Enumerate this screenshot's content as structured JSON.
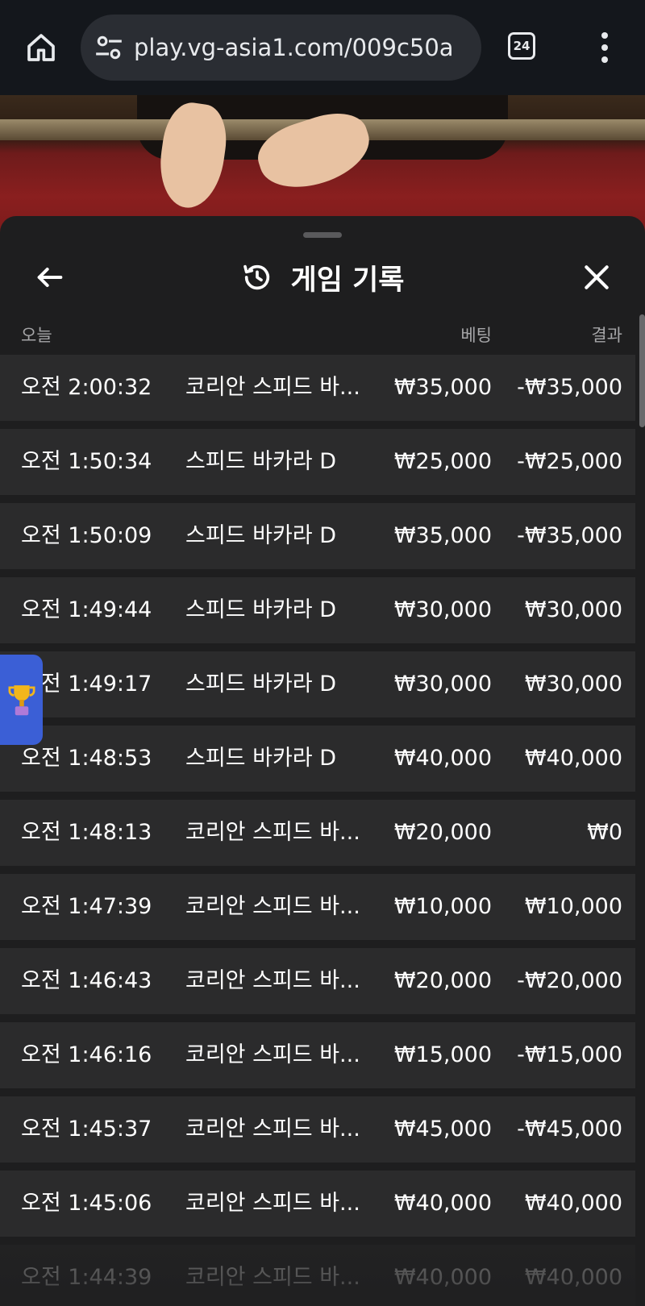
{
  "browser": {
    "url": "play.vg-asia1.com/009c50a",
    "tab_count": "24"
  },
  "sheet": {
    "title": "게임 기록",
    "columns": {
      "today": "오늘",
      "bet": "베팅",
      "result": "결과"
    },
    "rows": [
      {
        "time": "오전 2:00:32",
        "game": "코리안 스피드 바...",
        "bet": "₩35,000",
        "result": "-₩35,000"
      },
      {
        "time": "오전 1:50:34",
        "game": "스피드 바카라 D",
        "bet": "₩25,000",
        "result": "-₩25,000"
      },
      {
        "time": "오전 1:50:09",
        "game": "스피드 바카라 D",
        "bet": "₩35,000",
        "result": "-₩35,000"
      },
      {
        "time": "오전 1:49:44",
        "game": "스피드 바카라 D",
        "bet": "₩30,000",
        "result": "₩30,000"
      },
      {
        "time": "오전 1:49:17",
        "game": "스피드 바카라 D",
        "bet": "₩30,000",
        "result": "₩30,000"
      },
      {
        "time": "오전 1:48:53",
        "game": "스피드 바카라 D",
        "bet": "₩40,000",
        "result": "₩40,000"
      },
      {
        "time": "오전 1:48:13",
        "game": "코리안 스피드 바...",
        "bet": "₩20,000",
        "result": "₩0"
      },
      {
        "time": "오전 1:47:39",
        "game": "코리안 스피드 바...",
        "bet": "₩10,000",
        "result": "₩10,000"
      },
      {
        "time": "오전 1:46:43",
        "game": "코리안 스피드 바...",
        "bet": "₩20,000",
        "result": "-₩20,000"
      },
      {
        "time": "오전 1:46:16",
        "game": "코리안 스피드 바...",
        "bet": "₩15,000",
        "result": "-₩15,000"
      },
      {
        "time": "오전 1:45:37",
        "game": "코리안 스피드 바...",
        "bet": "₩45,000",
        "result": "-₩45,000"
      },
      {
        "time": "오전 1:45:06",
        "game": "코리안 스피드 바...",
        "bet": "₩40,000",
        "result": "₩40,000"
      },
      {
        "time": "오전 1:44:39",
        "game": "코리안 스피드 바...",
        "bet": "₩40,000",
        "result": "₩40,000"
      }
    ]
  },
  "icons": {
    "home": "home-icon",
    "site_settings": "tune-icon",
    "menu": "more-vert-icon",
    "back": "arrow-left-icon",
    "history": "history-icon",
    "close": "close-icon",
    "trophy": "trophy-icon"
  },
  "colors": {
    "sheet_bg": "#1e1e1f",
    "row_bg": "#2b2b2c",
    "trophy_tab": "#3b5fd6"
  }
}
